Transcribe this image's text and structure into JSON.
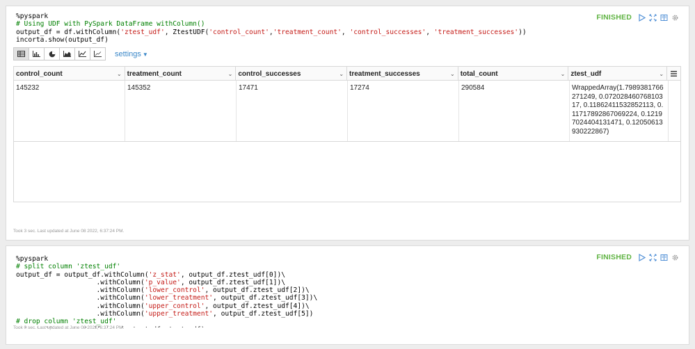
{
  "paragraph1": {
    "code_lines": [
      {
        "parts": [
          {
            "t": "%pyspark",
            "c": ""
          }
        ]
      },
      {
        "parts": [
          {
            "t": "# Using UDF with PySpark DataFrame withColumn()",
            "c": "c-comment"
          }
        ]
      },
      {
        "parts": [
          {
            "t": "output_df = df.withColumn(",
            "c": ""
          },
          {
            "t": "'ztest_udf'",
            "c": "c-str"
          },
          {
            "t": ", ZtestUDF(",
            "c": ""
          },
          {
            "t": "'control_count'",
            "c": "c-str"
          },
          {
            "t": ",",
            "c": ""
          },
          {
            "t": "'treatment_count'",
            "c": "c-str"
          },
          {
            "t": ", ",
            "c": ""
          },
          {
            "t": "'control_successes'",
            "c": "c-str"
          },
          {
            "t": ", ",
            "c": ""
          },
          {
            "t": "'treatment_successes'",
            "c": "c-str"
          },
          {
            "t": "))",
            "c": ""
          }
        ]
      },
      {
        "parts": [
          {
            "t": "incorta.show(output_df)",
            "c": ""
          }
        ]
      }
    ],
    "status": "FINISHED",
    "settings_label": "settings",
    "table": {
      "columns": [
        "control_count",
        "treatment_count",
        "control_successes",
        "treatment_successes",
        "total_count",
        "ztest_udf"
      ],
      "rows": [
        [
          "145232",
          "145352",
          "17471",
          "17274",
          "290584",
          "WrappedArray(1.7989381766271249, 0.07202846076810317, 0.11862411532852113, 0.11717892867069224, 0.12197024404131471, 0.12050613930222867)"
        ]
      ]
    },
    "footer": "Took 3 sec. Last updated at June 08 2022, 6:37:24 PM."
  },
  "paragraph2": {
    "code_lines": [
      {
        "parts": [
          {
            "t": "%pyspark",
            "c": ""
          }
        ]
      },
      {
        "parts": [
          {
            "t": "# split column 'ztest_udf'",
            "c": "c-comment"
          }
        ]
      },
      {
        "parts": [
          {
            "t": "output_df = output_df.withColumn(",
            "c": ""
          },
          {
            "t": "'z_stat'",
            "c": "c-str"
          },
          {
            "t": ", output_df.ztest_udf[0])\\",
            "c": ""
          }
        ]
      },
      {
        "parts": [
          {
            "t": "                    .withColumn(",
            "c": ""
          },
          {
            "t": "'p_value'",
            "c": "c-str"
          },
          {
            "t": ", output_df.ztest_udf[1])\\",
            "c": ""
          }
        ]
      },
      {
        "parts": [
          {
            "t": "                    .withColumn(",
            "c": ""
          },
          {
            "t": "'lower_control'",
            "c": "c-str"
          },
          {
            "t": ", output_df.ztest_udf[2])\\",
            "c": ""
          }
        ]
      },
      {
        "parts": [
          {
            "t": "                    .withColumn(",
            "c": ""
          },
          {
            "t": "'lower_treatment'",
            "c": "c-str"
          },
          {
            "t": ", output_df.ztest_udf[3])\\",
            "c": ""
          }
        ]
      },
      {
        "parts": [
          {
            "t": "                    .withColumn(",
            "c": ""
          },
          {
            "t": "'upper_control'",
            "c": "c-str"
          },
          {
            "t": ", output_df.ztest_udf[4])\\",
            "c": ""
          }
        ]
      },
      {
        "parts": [
          {
            "t": "                    .withColumn(",
            "c": ""
          },
          {
            "t": "'upper_treatment'",
            "c": "c-str"
          },
          {
            "t": ", output_df.ztest_udf[5])",
            "c": ""
          }
        ]
      },
      {
        "parts": [
          {
            "t": "# drop column 'ztest_udf'",
            "c": "c-comment"
          }
        ]
      },
      {
        "parts": [
          {
            "t": "output_df = output_df.drop(output_df.ztest_udf)",
            "c": ""
          }
        ]
      }
    ],
    "status": "FINISHED",
    "footer": "Took 0 sec. Last updated at June 08 2022, 6:37:24 PM."
  },
  "icons": {
    "run": "play-icon",
    "expand": "expand-icon",
    "book": "book-icon",
    "settings": "gear-icon",
    "toolbar": [
      "table-icon",
      "bar-chart-icon",
      "pie-chart-icon",
      "area-chart-icon",
      "line-chart-icon",
      "scatter-chart-icon"
    ]
  },
  "colors": {
    "status": "#5fb342",
    "accent": "#4f8fd6",
    "string": "#c41a16",
    "comment": "#008000"
  }
}
